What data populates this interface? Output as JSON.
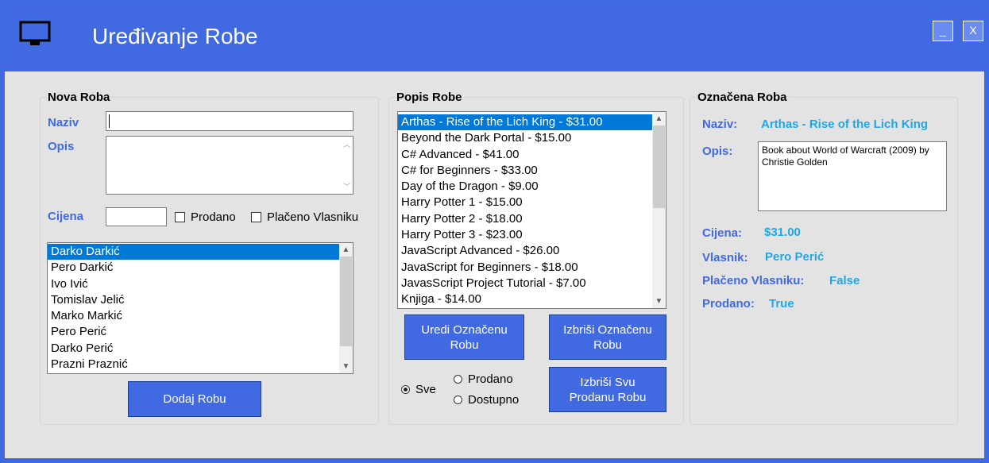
{
  "window": {
    "title": "Uređivanje Robe",
    "minimize_label": "_",
    "close_label": "X",
    "icon": "monitor-icon"
  },
  "nova_roba": {
    "group_title": "Nova Roba",
    "naziv_label": "Naziv",
    "naziv_value": "",
    "opis_label": "Opis",
    "opis_value": "",
    "cijena_label": "Cijena",
    "cijena_value": "",
    "prodano_label": "Prodano",
    "placeno_label": "Plačeno Vlasniku",
    "owners": [
      "Darko Darkić",
      "Pero Darkić",
      "Ivo Ivić",
      "Tomislav Jelić",
      "Marko Markić",
      "Pero Perić",
      "Darko Perić",
      "Prazni Praznić"
    ],
    "selected_owner_index": 0,
    "add_button": "Dodaj Robu"
  },
  "popis_robe": {
    "group_title": "Popis Robe",
    "items": [
      "Arthas - Rise of the Lich King - $31.00",
      "Beyond the Dark Portal - $15.00",
      "C# Advanced - $41.00",
      "C# for Beginners - $33.00",
      "Day of the Dragon - $9.00",
      "Harry Potter 1 - $15.00",
      "Harry Potter 2 - $18.00",
      "Harry Potter 3 - $23.00",
      "JavaScript Advanced - $26.00",
      "JavaScript for Beginners - $18.00",
      "JavasScript Project Tutorial - $7.00",
      "Knjiga - $14.00"
    ],
    "selected_index": 0,
    "edit_button": "Uredi Označenu Robu",
    "delete_button": "Izbriši Označenu Robu",
    "delete_sold_button": "Izbriši Svu Prodanu Robu",
    "filter_all": "Sve",
    "filter_sold": "Prodano",
    "filter_available": "Dostupno",
    "filter_selected": "Sve"
  },
  "oznacena_roba": {
    "group_title": "Označena Roba",
    "naziv_label": "Naziv:",
    "naziv_value": "Arthas - Rise of the Lich King",
    "opis_label": "Opis:",
    "opis_value": "Book about World of Warcraft (2009) by Christie Golden",
    "cijena_label": "Cijena:",
    "cijena_value": "$31.00",
    "vlasnik_label": "Vlasnik:",
    "vlasnik_value": "Pero Perić",
    "placeno_label": "Plačeno Vlasniku:",
    "placeno_value": "False",
    "prodano_label": "Prodano:",
    "prodano_value": "True"
  },
  "colors": {
    "accent": "#4169e1",
    "value_text": "#1ea7e8",
    "selection": "#0078d7",
    "background": "#e3e3e3"
  }
}
